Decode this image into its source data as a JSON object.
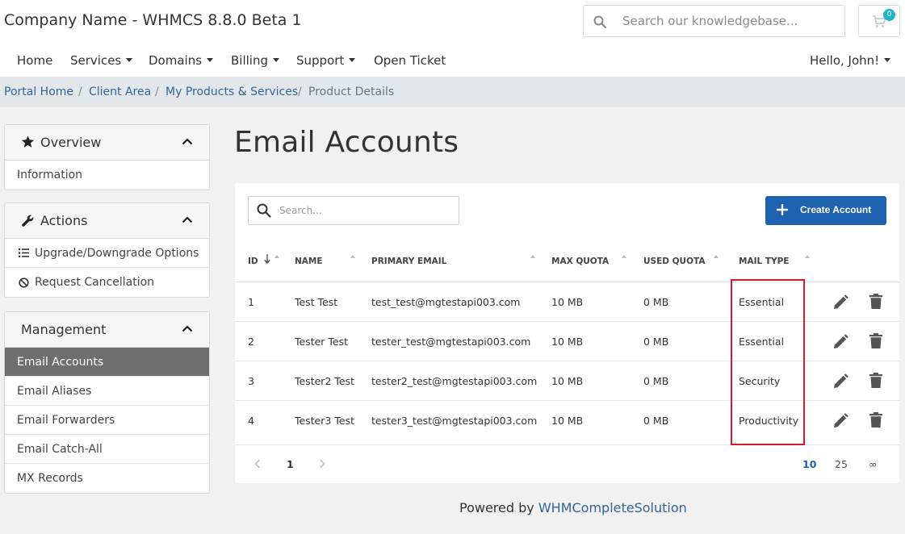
{
  "header": {
    "brand": "Company Name - WHMCS 8.8.0 Beta 1",
    "search_placeholder": "Search our knowledgebase...",
    "cart_count": "0"
  },
  "nav": {
    "items": [
      {
        "label": "Home",
        "dropdown": false
      },
      {
        "label": "Services",
        "dropdown": true
      },
      {
        "label": "Domains",
        "dropdown": true
      },
      {
        "label": "Billing",
        "dropdown": true
      },
      {
        "label": "Support",
        "dropdown": true
      },
      {
        "label": "Open Ticket",
        "dropdown": false
      }
    ],
    "user": "Hello, John!"
  },
  "breadcrumb": {
    "items": [
      "Portal Home",
      "Client Area",
      "My Products & Services"
    ],
    "active": "Product Details",
    "separator": "/"
  },
  "sidebar": {
    "overview": {
      "title": "Overview",
      "items": [
        "Information"
      ]
    },
    "actions": {
      "title": "Actions",
      "items": [
        "Upgrade/Downgrade Options",
        "Request Cancellation"
      ]
    },
    "management": {
      "title": "Management",
      "items": [
        "Email Accounts",
        "Email Aliases",
        "Email Forwarders",
        "Email Catch-All",
        "MX Records"
      ],
      "active": "Email Accounts"
    }
  },
  "main": {
    "title": "Email Accounts",
    "search_placeholder": "Search...",
    "create_label": "Create Account",
    "columns": [
      "ID",
      "NAME",
      "PRIMARY EMAIL",
      "MAX QUOTA",
      "USED QUOTA",
      "MAIL TYPE"
    ],
    "rows": [
      {
        "id": "1",
        "name": "Test Test",
        "email": "test_test@mgtestapi003.com",
        "max_quota": "10 MB",
        "used_quota": "0 MB",
        "mail_type": "Essential"
      },
      {
        "id": "2",
        "name": "Tester Test",
        "email": "tester_test@mgtestapi003.com",
        "max_quota": "10 MB",
        "used_quota": "0 MB",
        "mail_type": "Essential"
      },
      {
        "id": "3",
        "name": "Tester2 Test",
        "email": "tester2_test@mgtestapi003.com",
        "max_quota": "10 MB",
        "used_quota": "0 MB",
        "mail_type": "Security"
      },
      {
        "id": "4",
        "name": "Tester3 Test",
        "email": "tester3_test@mgtestapi003.com",
        "max_quota": "10 MB",
        "used_quota": "0 MB",
        "mail_type": "Productivity"
      }
    ],
    "pagination": {
      "page": "1",
      "sizes": [
        "10",
        "25",
        "∞"
      ],
      "active_size": "10"
    }
  },
  "footer": {
    "prefix": "Powered by ",
    "link": "WHMCompleteSolution"
  },
  "colors": {
    "accent": "#1e62b0",
    "link": "#33649c",
    "highlight": "#d6182b",
    "active_item": "#6e6e6e",
    "badge": "#1fb4c8"
  }
}
